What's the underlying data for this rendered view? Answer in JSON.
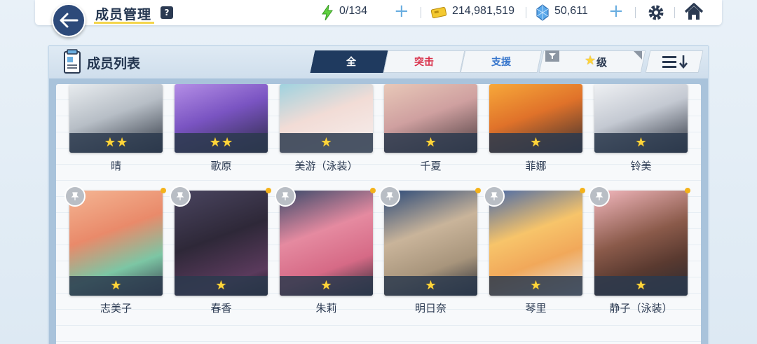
{
  "header": {
    "title": "成员管理",
    "help_label": "?",
    "ap": "0/134",
    "credits": "214,981,519",
    "pyroxene": "50,611"
  },
  "panel": {
    "title": "成员列表",
    "tabs": [
      {
        "label": "全",
        "active": true
      },
      {
        "label": "突击",
        "active": false
      },
      {
        "label": "支援",
        "active": false
      }
    ],
    "filter_label": "级"
  },
  "colors": {
    "navy": "#1f3a5f",
    "striker_red": "#d9304a",
    "support_blue": "#3776cc",
    "star_yellow": "#ffd43b"
  },
  "students_row1": [
    {
      "name": "晴",
      "stars": 2
    },
    {
      "name": "歌原",
      "stars": 2
    },
    {
      "name": "美游（泳装）",
      "stars": 1
    },
    {
      "name": "千夏",
      "stars": 1
    },
    {
      "name": "菲娜",
      "stars": 1
    },
    {
      "name": "铃美",
      "stars": 1
    }
  ],
  "students_row2": [
    {
      "name": "志美子",
      "stars": 1
    },
    {
      "name": "春香",
      "stars": 1
    },
    {
      "name": "朱莉",
      "stars": 1
    },
    {
      "name": "明日奈",
      "stars": 1
    },
    {
      "name": "琴里",
      "stars": 1
    },
    {
      "name": "静子（泳装）",
      "stars": 1
    }
  ]
}
